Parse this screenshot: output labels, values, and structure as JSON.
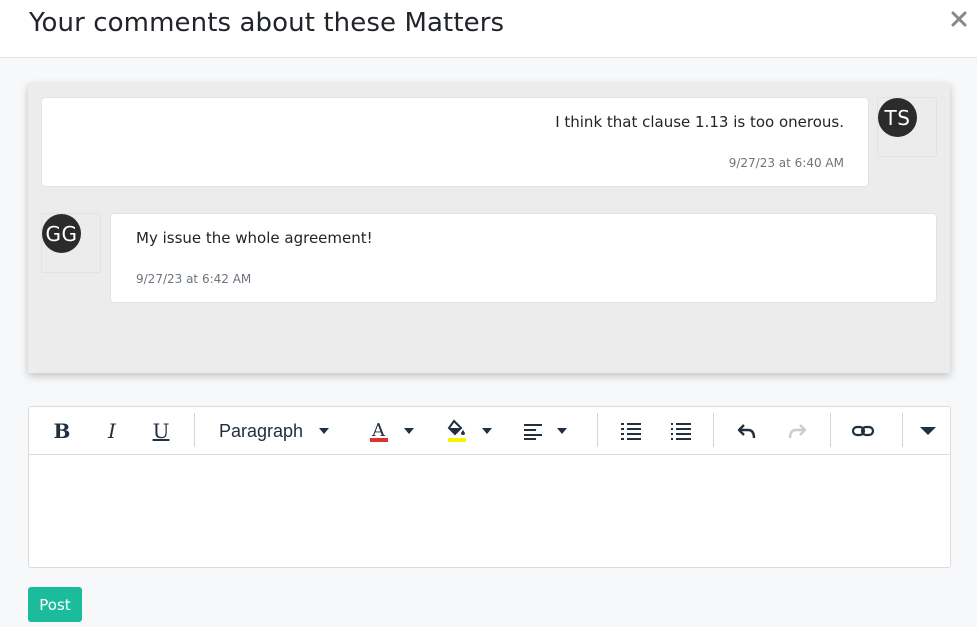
{
  "modal": {
    "title": "Your comments about these Matters",
    "close_icon": "close-icon"
  },
  "comments": [
    {
      "author_initials": "TS",
      "text": "I think that clause 1.13 is too onerous.",
      "timestamp": "9/27/23 at 6:40 AM",
      "side": "right"
    },
    {
      "author_initials": "GG",
      "text": "My issue the whole agreement!",
      "timestamp": "9/27/23 at 6:42 AM",
      "side": "left"
    }
  ],
  "editor": {
    "toolbar": {
      "bold": "bold-icon",
      "italic": "italic-icon",
      "underline": "underline-icon",
      "block_format_label": "Paragraph",
      "text_color": "#e03131",
      "highlight_color": "#f5f500",
      "align": "align-left-icon",
      "numbered_list": "numbered-list-icon",
      "bulleted_list": "bulleted-list-icon",
      "undo": "undo-icon",
      "redo": "redo-icon",
      "link": "link-icon",
      "more": "more-drawer-icon"
    },
    "content": ""
  },
  "actions": {
    "post_label": "Post"
  },
  "colors": {
    "accent": "#1abc9c",
    "avatar_bg": "#2b2b2b",
    "panel_bg": "#ececec"
  }
}
